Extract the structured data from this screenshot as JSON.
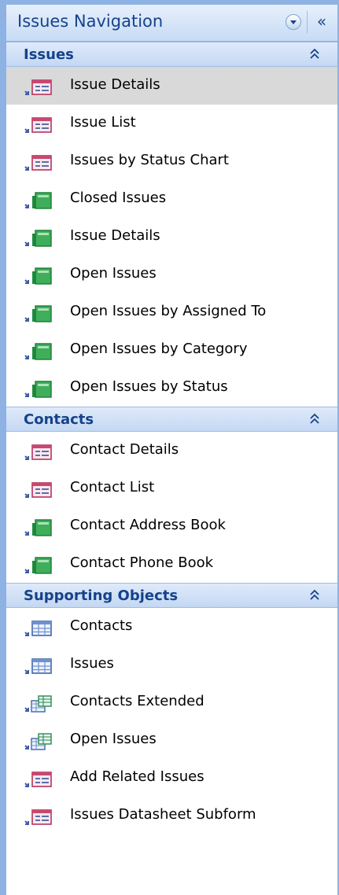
{
  "header": {
    "title": "Issues Navigation",
    "menu_icon": "dropdown-menu-icon",
    "collapse_icon": "shutter-close-icon",
    "collapse_glyph": "«"
  },
  "groups": [
    {
      "label": "Issues",
      "items": [
        {
          "label": "Issue Details",
          "icon": "form",
          "selected": true
        },
        {
          "label": "Issue List",
          "icon": "form"
        },
        {
          "label": "Issues by Status Chart",
          "icon": "form"
        },
        {
          "label": "Closed Issues",
          "icon": "report"
        },
        {
          "label": "Issue Details",
          "icon": "report"
        },
        {
          "label": "Open Issues",
          "icon": "report"
        },
        {
          "label": "Open Issues by Assigned To",
          "icon": "report"
        },
        {
          "label": "Open Issues by Category",
          "icon": "report"
        },
        {
          "label": "Open Issues by Status",
          "icon": "report"
        }
      ]
    },
    {
      "label": "Contacts",
      "items": [
        {
          "label": "Contact Details",
          "icon": "form"
        },
        {
          "label": "Contact List",
          "icon": "form"
        },
        {
          "label": "Contact Address Book",
          "icon": "report"
        },
        {
          "label": "Contact Phone Book",
          "icon": "report"
        }
      ]
    },
    {
      "label": "Supporting Objects",
      "items": [
        {
          "label": "Contacts",
          "icon": "table"
        },
        {
          "label": "Issues",
          "icon": "table"
        },
        {
          "label": "Contacts Extended",
          "icon": "query"
        },
        {
          "label": "Open Issues",
          "icon": "query"
        },
        {
          "label": "Add Related Issues",
          "icon": "form"
        },
        {
          "label": "Issues Datasheet Subform",
          "icon": "form"
        }
      ]
    }
  ],
  "colors": {
    "accent": "#15428b",
    "pane_border": "#8db2e3",
    "selected_row": "#d9d9d9"
  }
}
